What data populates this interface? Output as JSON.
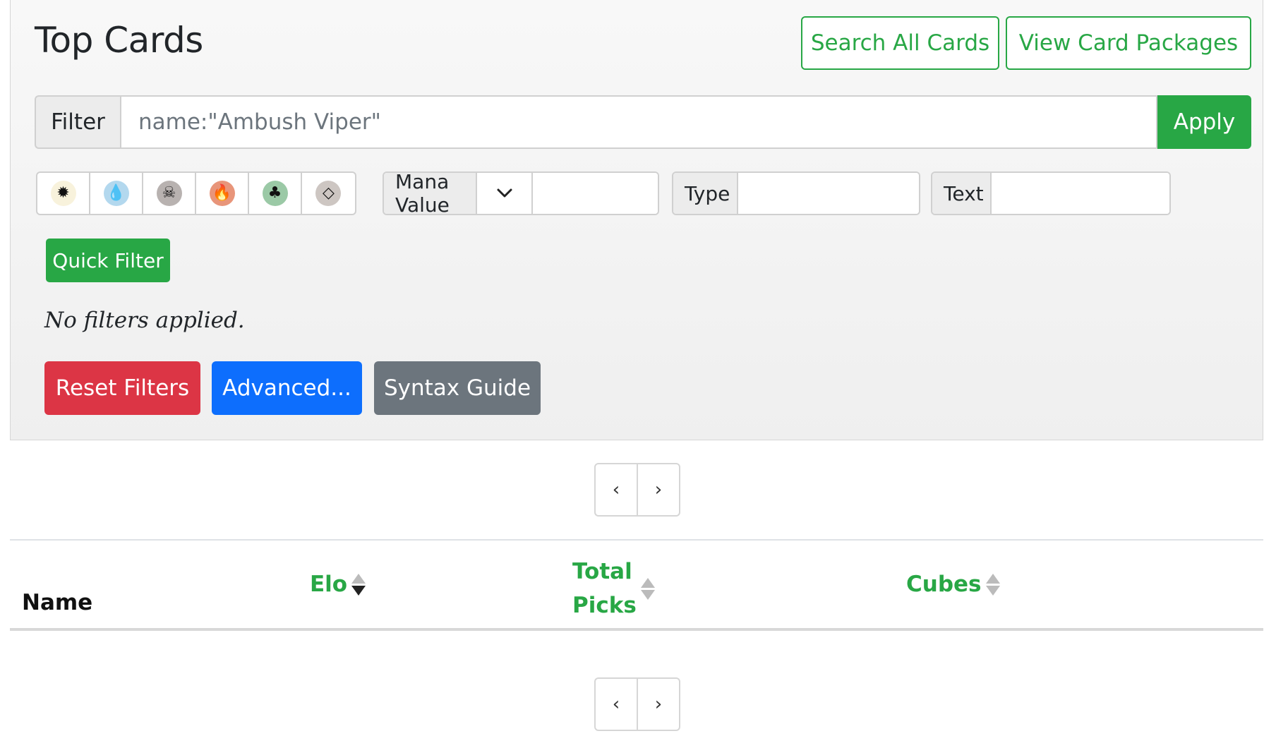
{
  "header": {
    "title": "Top Cards",
    "search_all_label": "Search All Cards",
    "view_packages_label": "View Card Packages"
  },
  "filter": {
    "addon_label": "Filter",
    "placeholder": "name:\"Ambush Viper\"",
    "apply_label": "Apply"
  },
  "colors": [
    {
      "name": "white",
      "glyph": "✹",
      "bg": "#f8f2dc"
    },
    {
      "name": "blue",
      "glyph": "💧",
      "bg": "#b3d8ee"
    },
    {
      "name": "black",
      "glyph": "☠",
      "bg": "#b8b2b0"
    },
    {
      "name": "red",
      "glyph": "🔥",
      "bg": "#e8957a"
    },
    {
      "name": "green",
      "glyph": "♣",
      "bg": "#9bc9a6"
    },
    {
      "name": "colorless",
      "glyph": "◇",
      "bg": "#cdc6c2"
    }
  ],
  "mana_value": {
    "label": "Mana Value"
  },
  "type_filter": {
    "label": "Type"
  },
  "text_filter": {
    "label": "Text"
  },
  "quick_filter_label": "Quick Filter",
  "status_text": "No filters applied.",
  "actions": {
    "reset_label": "Reset Filters",
    "advanced_label": "Advanced...",
    "syntax_label": "Syntax Guide"
  },
  "pager": {
    "prev": "‹",
    "next": "›"
  },
  "table": {
    "columns": {
      "name": "Name",
      "elo": "Elo",
      "total_picks_line1": "Total",
      "total_picks_line2": "Picks",
      "cubes": "Cubes"
    }
  },
  "colors_accent": {
    "green": "#28a745",
    "red": "#dc3545",
    "blue": "#0d6efd",
    "gray": "#6c757d"
  }
}
